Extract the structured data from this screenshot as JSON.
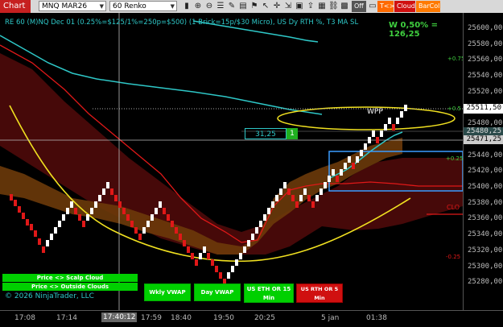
{
  "toolbar": {
    "chart_tab": "Chart",
    "instrument": "MNQ MAR26",
    "period": "60 Renko",
    "off_label": "Off",
    "tk_label": "T<>K",
    "cloud_label": "Cloud",
    "barcol_label": "BarCol"
  },
  "header": {
    "title": "RE 60 (M)NQ Dec 01 (0.25%=$125/1%=250p=$500) (1 Brick=15p/$30 Micro), US Dy RTH %, T3 MA SL",
    "wpr": "W 0,50% = 126,25",
    "wpp_label": "WPP",
    "copyright": "© 2026 NinjaTrader, LLC"
  },
  "percent_labels": {
    "p075": "+0.75",
    "p05": "+0.5",
    "p025": "+0.25",
    "m025": "-0.25",
    "clo": "CLO"
  },
  "price_axis": [
    "25600,00",
    "25580,00",
    "25560,00",
    "25540,00",
    "25520,00",
    "25500,00",
    "25480,00",
    "25460,00",
    "25440,00",
    "25420,00",
    "25400,00",
    "25380,00",
    "25360,00",
    "25340,00",
    "25320,00",
    "25300,00",
    "25280,00"
  ],
  "price_tags": {
    "last": "25511,50",
    "p1": "25480,25",
    "p2": "25471,25"
  },
  "crosshair": {
    "value": "31,25",
    "count": "1",
    "time": "17:40:12"
  },
  "time_axis": [
    "17:08",
    "17:14",
    "17:40:12",
    "17:59",
    "18:40",
    "19:50",
    "20:25",
    "5 jan",
    "01:38"
  ],
  "buttons": {
    "price_scalp": "Price <> Scalp Cloud",
    "price_outside": "Price <> Outside Clouds",
    "wkly_vwap": "Wkly VWAP",
    "day_vwap": "Day VWAP",
    "us_eth": "US ETH OR 15 Min",
    "us_rth": "US RTH OR 5 Min"
  },
  "colors": {
    "accent": "#2ec7c7",
    "green": "#00d000",
    "red": "#d01010",
    "yellow": "#f0e020",
    "blue": "#3a9cff"
  }
}
